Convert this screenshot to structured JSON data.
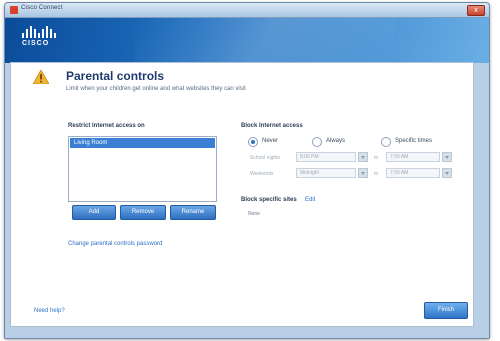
{
  "window": {
    "title": "Cisco Connect",
    "close_glyph": "x"
  },
  "header": {
    "logo_text": "CISCO"
  },
  "page": {
    "title": "Parental controls",
    "subtitle": "Limit when your children get online and what websites they can visit"
  },
  "restrict": {
    "label": "Restrict Internet access on",
    "items": [
      "Living Room"
    ],
    "buttons": {
      "add": "Add",
      "remove": "Remove",
      "rename": "Rename"
    }
  },
  "block_access": {
    "label": "Block Internet access",
    "options": [
      {
        "label": "Never",
        "selected": true
      },
      {
        "label": "Always",
        "selected": false
      },
      {
        "label": "Specific times",
        "selected": false
      }
    ],
    "schooldays": {
      "label": "School nights",
      "from": "8:00 PM",
      "to": "7:00 AM",
      "sep": "to"
    },
    "weekends": {
      "label": "Weekends",
      "from": "Midnight",
      "to": "7:00 AM",
      "sep": "to"
    }
  },
  "block_sites": {
    "label": "Block specific sites",
    "edit_label": "Edit",
    "value": "None"
  },
  "links": {
    "change_password": "Change parental controls password",
    "need_help": "Need help?"
  },
  "footer": {
    "finish_label": "Finish"
  },
  "colors": {
    "accent": "#2f6fc0",
    "header": "#1f6bbd",
    "warning": "#f2b233"
  },
  "icons": {
    "warning": "warning-icon",
    "app": "cisco-app-icon"
  }
}
